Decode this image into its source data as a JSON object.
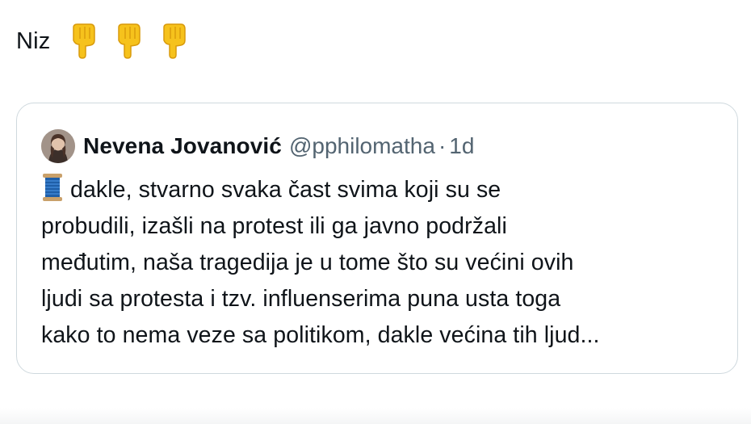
{
  "tweet": {
    "text": "Niz",
    "emojis": [
      "pointing-down-emoji",
      "pointing-down-emoji",
      "pointing-down-emoji"
    ]
  },
  "quote": {
    "author_name": "Nevena Jovanović",
    "handle": "@pphilomatha",
    "separator": "·",
    "time": "1d",
    "thread_icon": "thread-spool-emoji",
    "lines": [
      "dakle, stvarno svaka čast svima koji su se",
      "probudili, izašli na protest ili ga javno podržali",
      "međutim, naša tragedija je u tome što su većini ovih",
      "ljudi sa protesta i tzv. influenserima puna usta toga",
      "kako to nema veze sa politikom, dakle većina tih ljud..."
    ]
  },
  "colors": {
    "text": "#0f1419",
    "secondary": "#536471",
    "border": "#cfd9de",
    "emoji_yellow": "#f6c21c",
    "thread_blue": "#1f5fa8"
  }
}
